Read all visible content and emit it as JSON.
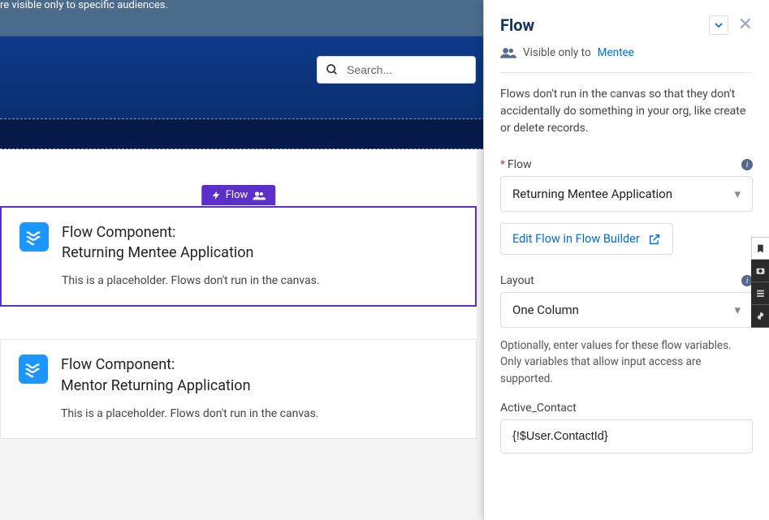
{
  "topnote": "re visible only to specific audiences.",
  "search": {
    "placeholder": "Search..."
  },
  "canvas": {
    "tag_label": "Flow",
    "components": [
      {
        "title_prefix": "Flow Component:",
        "title": "Returning Mentee Application",
        "placeholder": "This is a placeholder. Flows don't run in the canvas."
      },
      {
        "title_prefix": "Flow Component:",
        "title": "Mentor Returning Application",
        "placeholder": "This is a placeholder. Flows don't run in the canvas."
      }
    ]
  },
  "panel": {
    "title": "Flow",
    "visibility": {
      "prefix": "Visible only to",
      "audience": "Mentee"
    },
    "description": "Flows don't run in the canvas so that they don't accidentally do something in your org, like create or delete records.",
    "flow_field": {
      "label": "Flow",
      "value": "Returning Mentee Application"
    },
    "edit_link": "Edit Flow in Flow Builder",
    "layout_field": {
      "label": "Layout",
      "value": "One Column"
    },
    "vars_help": "Optionally, enter values for these flow variables. Only variables that allow input access are supported.",
    "var1": {
      "label": "Active_Contact",
      "value": "{!$User.ContactId}"
    }
  }
}
